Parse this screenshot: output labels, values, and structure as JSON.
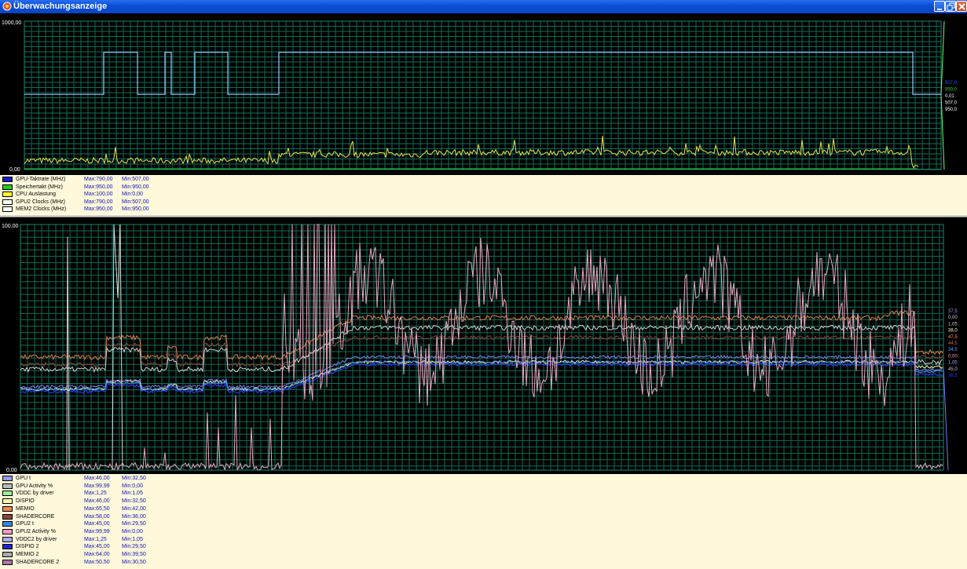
{
  "window": {
    "title": "Überwachungsanzeige",
    "icon": "monitor-app-icon"
  },
  "colors": {
    "chart_bg": "#000000",
    "grid": "#0f6b57",
    "legend_bg": "#fff9dc",
    "value_text": "#1010b0"
  },
  "chart_top": {
    "y_max_label": "1000,00",
    "y_min_label": "0,00",
    "ylim": [
      0,
      1000
    ],
    "right_labels": [
      {
        "text": "507,0",
        "color": "#2255ff"
      },
      {
        "text": "950,0",
        "color": "#33cc33"
      },
      {
        "text": "0,01",
        "color": "#ffffff"
      },
      {
        "text": "507,0",
        "color": "#ffffff"
      },
      {
        "text": "950,0",
        "color": "#ffffff"
      }
    ],
    "legend": [
      {
        "name": "GPU-Taktrate (MHz)",
        "max": "Max:790,00",
        "min": "Min:507,00",
        "color": "#1a1acc"
      },
      {
        "name": "Speichertakt (MHz)",
        "max": "Max:950,00",
        "min": "Min:950,00",
        "color": "#22cc22"
      },
      {
        "name": "CPU Auslastung",
        "max": "Max:100,00",
        "min": "Min:0,00",
        "color": "#ffff33"
      },
      {
        "name": "GPU2 Clocks (MHz)",
        "max": "Max:790,00",
        "min": "Min:507,00",
        "color": "#ffffff"
      },
      {
        "name": "MEM2 Clocks (MHz)",
        "max": "Max:950,00",
        "min": "Min:950,00",
        "color": "#ffffff"
      }
    ]
  },
  "chart_bottom": {
    "y_max_label": "100,00",
    "y_min_label": "0,00",
    "ylim": [
      0,
      100
    ],
    "right_labels": [
      {
        "text": "37,5",
        "color": "#9999ff"
      },
      {
        "text": "0,00",
        "color": "#cccccc"
      },
      {
        "text": "1,05",
        "color": "#cccccc"
      },
      {
        "text": "38,0",
        "color": "#ffffcc"
      },
      {
        "text": "47,5",
        "color": "#ff9966"
      },
      {
        "text": "44,5",
        "color": "#bb6655"
      },
      {
        "text": "34,5",
        "color": "#6699ff"
      },
      {
        "text": "0,00",
        "color": "#ff99bb"
      },
      {
        "text": "1,05",
        "color": "#aaaaff"
      },
      {
        "text": "45,0",
        "color": "#cccccc"
      },
      {
        "text": "38,5",
        "color": "#3333ff"
      }
    ],
    "legend": [
      {
        "name": "GPU t",
        "max": "Max:46,00",
        "min": "Min:32,50",
        "color": "#9999ee"
      },
      {
        "name": "GPU Activity %",
        "max": "Max:99,99",
        "min": "Min:0,00",
        "color": "#bbbbbb"
      },
      {
        "name": "VDDC by driver",
        "max": "Max:1,25",
        "min": "Min:1,05",
        "color": "#99ee99"
      },
      {
        "name": "DISPIO",
        "max": "Max:46,00",
        "min": "Min:32,50",
        "color": "#ffffaa"
      },
      {
        "name": "MEMIO",
        "max": "Max:65,50",
        "min": "Min:42,00",
        "color": "#ee8855"
      },
      {
        "name": "SHADERCORE",
        "max": "Max:58,00",
        "min": "Min:36,00",
        "color": "#884444"
      },
      {
        "name": "GPU2 t",
        "max": "Max:45,00",
        "min": "Min:29,50",
        "color": "#3388ee"
      },
      {
        "name": "GPU2 Activity %",
        "max": "Max:99,99",
        "min": "Min:0,00",
        "color": "#ff99cc"
      },
      {
        "name": "VDDC2 by driver",
        "max": "Max:1,25",
        "min": "Min:1,05",
        "color": "#aaaaff"
      },
      {
        "name": "DISPIO 2",
        "max": "Max:45,00",
        "min": "Min:29,50",
        "color": "#2222dd"
      },
      {
        "name": "MEMIO 2",
        "max": "Max:64,00",
        "min": "Min:39,50",
        "color": "#aaaaaa"
      },
      {
        "name": "SHADERCORE 2",
        "max": "Max:50,50",
        "min": "Min:30,50",
        "color": "#aa77aa"
      }
    ]
  }
}
